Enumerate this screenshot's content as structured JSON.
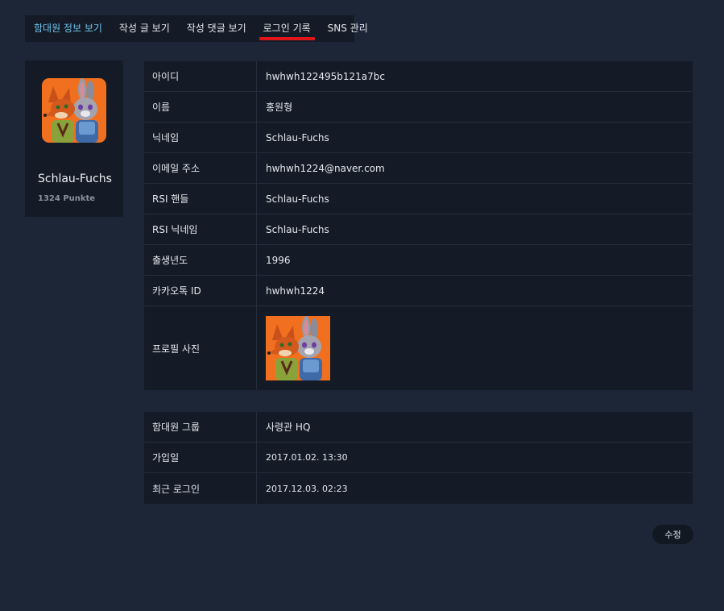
{
  "tabs": [
    {
      "label": "함대원 정보 보기"
    },
    {
      "label": "작성 글 보기"
    },
    {
      "label": "작성 댓글 보기"
    },
    {
      "label": "로그인 기록"
    },
    {
      "label": "SNS 관리"
    }
  ],
  "profile": {
    "name": "Schlau-Fuchs",
    "points": "1324 Punkte"
  },
  "info": {
    "rows": [
      {
        "label": "아이디",
        "value": "hwhwh122495b121a7bc"
      },
      {
        "label": "이름",
        "value": "홍원형"
      },
      {
        "label": "닉네임",
        "value": "Schlau-Fuchs"
      },
      {
        "label": "이메일 주소",
        "value": "hwhwh1224@naver.com"
      },
      {
        "label": "RSI 핸들",
        "value": "Schlau-Fuchs"
      },
      {
        "label": "RSI 닉네임",
        "value": "Schlau-Fuchs"
      },
      {
        "label": "출생년도",
        "value": "1996"
      },
      {
        "label": "카카오톡 ID",
        "value": "hwhwh1224"
      },
      {
        "label": "프로필 사진",
        "value": ""
      }
    ]
  },
  "membership": {
    "rows": [
      {
        "label": "함대원 그룹",
        "value": "사령관 HQ"
      },
      {
        "label": "가입일",
        "value": "2017.01.02. 13:30"
      },
      {
        "label": "최근 로그인",
        "value": "2017.12.03. 02:23"
      }
    ]
  },
  "actions": {
    "edit_label": "수정"
  },
  "colors": {
    "background": "#1d2636",
    "panel": "#141b26",
    "accent_tab": "#6fc4ee",
    "active_underline": "#e0151c",
    "avatar_bg": "#f07020"
  },
  "icons": {
    "avatar": "fox-and-rabbit-avatar",
    "photo": "fox-and-rabbit-photo"
  }
}
